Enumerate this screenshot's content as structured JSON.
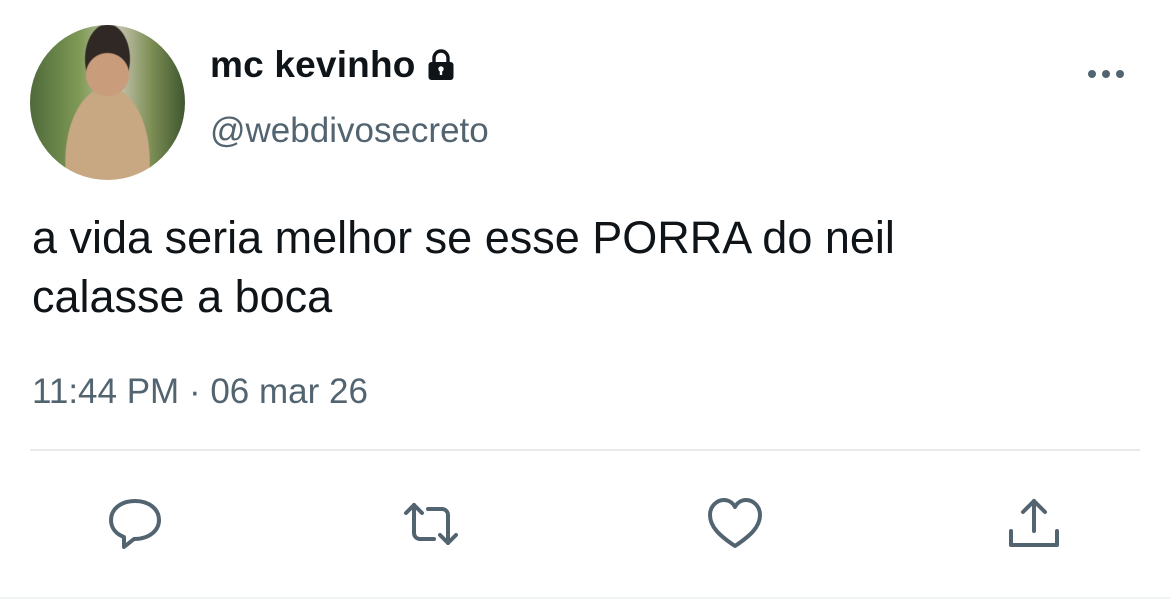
{
  "tweet": {
    "author_name": "mc kevinho",
    "author_handle": "@webdivosecreto",
    "text_lines": [
      "a vida seria melhor se esse PORRA do neil",
      "calasse a boca"
    ],
    "time": "11:44 PM",
    "separator": "·",
    "date": "06 mar 26"
  },
  "icons": {
    "lock": "lock-icon",
    "more": "more-icon",
    "reply": "reply-icon",
    "retweet": "retweet-icon",
    "like": "heart-icon",
    "share": "share-icon"
  },
  "colors": {
    "text": "#0f1419",
    "secondary": "#536471",
    "icon": "#536471",
    "divider": "#e7e9ea"
  }
}
